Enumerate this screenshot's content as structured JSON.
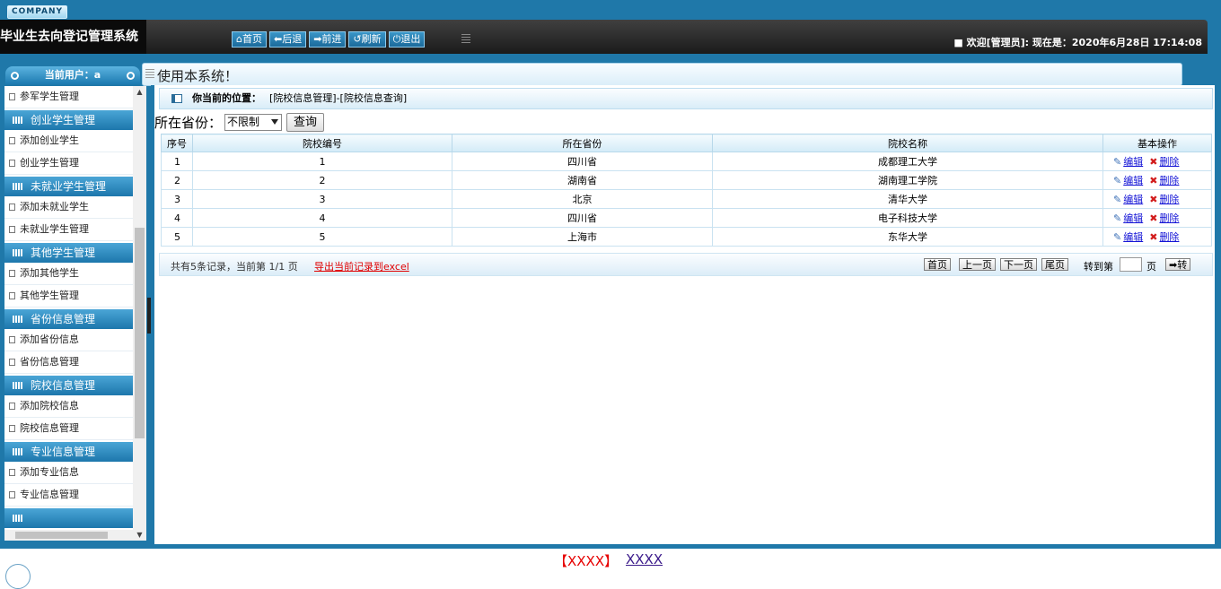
{
  "header": {
    "company": "COMPANY",
    "app_title": "毕业生去向登记管理系统",
    "nav": [
      {
        "icon": "home-icon",
        "glyph": "⌂",
        "label": "首页"
      },
      {
        "icon": "back-icon",
        "glyph": "⬅",
        "label": "后退"
      },
      {
        "icon": "forward-icon",
        "glyph": "➡",
        "label": "前进"
      },
      {
        "icon": "refresh-icon",
        "glyph": "↺",
        "label": "刷新"
      },
      {
        "icon": "logout-icon",
        "glyph": "⏻",
        "label": "退出"
      }
    ],
    "welcome": "■ 欢迎[管理员]:  现在是：2020年6月28日 17:14:08"
  },
  "sidebar": {
    "current_user": "当前用户：a",
    "menu": [
      {
        "type": "item",
        "label": "参军学生管理"
      },
      {
        "type": "head",
        "label": "创业学生管理"
      },
      {
        "type": "item",
        "label": "添加创业学生"
      },
      {
        "type": "item",
        "label": "创业学生管理"
      },
      {
        "type": "head",
        "label": "未就业学生管理"
      },
      {
        "type": "item",
        "label": "添加未就业学生"
      },
      {
        "type": "item",
        "label": "未就业学生管理"
      },
      {
        "type": "head",
        "label": "其他学生管理"
      },
      {
        "type": "item",
        "label": "添加其他学生"
      },
      {
        "type": "item",
        "label": "其他学生管理"
      },
      {
        "type": "head",
        "label": "省份信息管理"
      },
      {
        "type": "item",
        "label": "添加省份信息"
      },
      {
        "type": "item",
        "label": "省份信息管理"
      },
      {
        "type": "head",
        "label": "院校信息管理"
      },
      {
        "type": "item",
        "label": "添加院校信息"
      },
      {
        "type": "item",
        "label": "院校信息管理"
      },
      {
        "type": "head",
        "label": "专业信息管理"
      },
      {
        "type": "item",
        "label": "添加专业信息"
      },
      {
        "type": "item",
        "label": "专业信息管理"
      }
    ]
  },
  "notice": "使用本系统！",
  "breadcrumb": {
    "label": "你当前的位置：",
    "path": "[院校信息管理]-[院校信息查询]"
  },
  "filter": {
    "label": "所在省份：",
    "selected": "不限制",
    "query_button": "查询"
  },
  "table": {
    "columns": [
      "序号",
      "院校编号",
      "所在省份",
      "院校名称",
      "基本操作"
    ],
    "rows": [
      {
        "index": "1",
        "code": "1",
        "province": "四川省",
        "name": "成都理工大学"
      },
      {
        "index": "2",
        "code": "2",
        "province": "湖南省",
        "name": "湖南理工学院"
      },
      {
        "index": "3",
        "code": "3",
        "province": "北京",
        "name": "清华大学"
      },
      {
        "index": "4",
        "code": "4",
        "province": "四川省",
        "name": "电子科技大学"
      },
      {
        "index": "5",
        "code": "5",
        "province": "上海市",
        "name": "东华大学"
      }
    ],
    "edit_label": "编辑",
    "delete_label": "删除"
  },
  "pager": {
    "info": "共有5条记录，当前第 1/1 页",
    "export": "导出当前记录到excel",
    "first": "首页",
    "prev": "上一页",
    "next": "下一页",
    "last": "尾页",
    "goto_label": "转到第",
    "goto_value": "",
    "page_unit": "页",
    "go_button": "➡转"
  },
  "footer": {
    "red_text": "【XXXX】",
    "link_text": "XXXX"
  }
}
